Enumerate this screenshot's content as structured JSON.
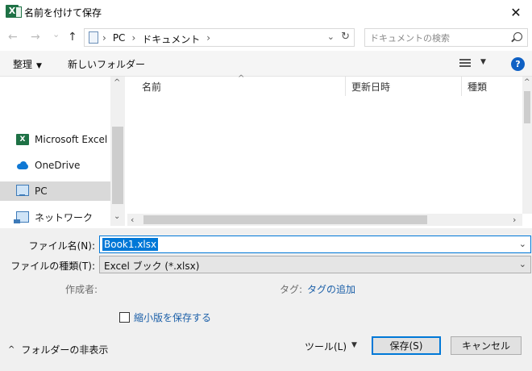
{
  "window": {
    "title": "名前を付けて保存",
    "app_icon_letter": "X",
    "close_glyph": "✕"
  },
  "address_bar": {
    "back_glyph": "←",
    "forward_glyph": "→",
    "recent_glyph": "⌄",
    "up_glyph": "↑",
    "separator": "›",
    "crumbs": [
      "PC",
      "ドキュメント"
    ],
    "dropdown_glyph": "⌄",
    "refresh_glyph": "↻"
  },
  "search": {
    "placeholder": "ドキュメントの検索"
  },
  "toolbar": {
    "organize_label": "整理",
    "organize_caret": "▼",
    "new_folder_label": "新しいフォルダー",
    "view_caret": "▼",
    "help_label": "?"
  },
  "navigation": {
    "items": [
      {
        "label": "Microsoft Excel",
        "icon": "excel-icon"
      },
      {
        "label": "OneDrive",
        "icon": "onedrive-icon"
      },
      {
        "label": "PC",
        "icon": "pc-icon",
        "selected": true
      },
      {
        "label": "ネットワーク",
        "icon": "network-icon"
      }
    ],
    "scroll_up_glyph": "^",
    "scroll_down_glyph": "⌄"
  },
  "file_list": {
    "columns": [
      {
        "label": "名前"
      },
      {
        "label": "更新日時"
      },
      {
        "label": "種類"
      }
    ],
    "sort_glyph": "^",
    "scroll_up_glyph": "^",
    "scroll_left_glyph": "‹",
    "scroll_right_glyph": "›"
  },
  "form": {
    "filename_label": "ファイル名(N):",
    "filename_value": "Book1.xlsx",
    "filetype_label": "ファイルの種類(T):",
    "filetype_value": "Excel ブック (*.xlsx)",
    "dropdown_glyph": "⌄",
    "author_label": "作成者:",
    "tags_label": "タグ:",
    "tags_link": "タグの追加",
    "save_thumbnail_label": "縮小版を保存する",
    "save_thumbnail_checked": false
  },
  "footer": {
    "hide_folders_glyph": "^",
    "hide_folders_label": "フォルダーの非表示",
    "tools_label": "ツール(L)",
    "tools_caret": "▼",
    "save_label": "保存(S)",
    "cancel_label": "キャンセル"
  }
}
